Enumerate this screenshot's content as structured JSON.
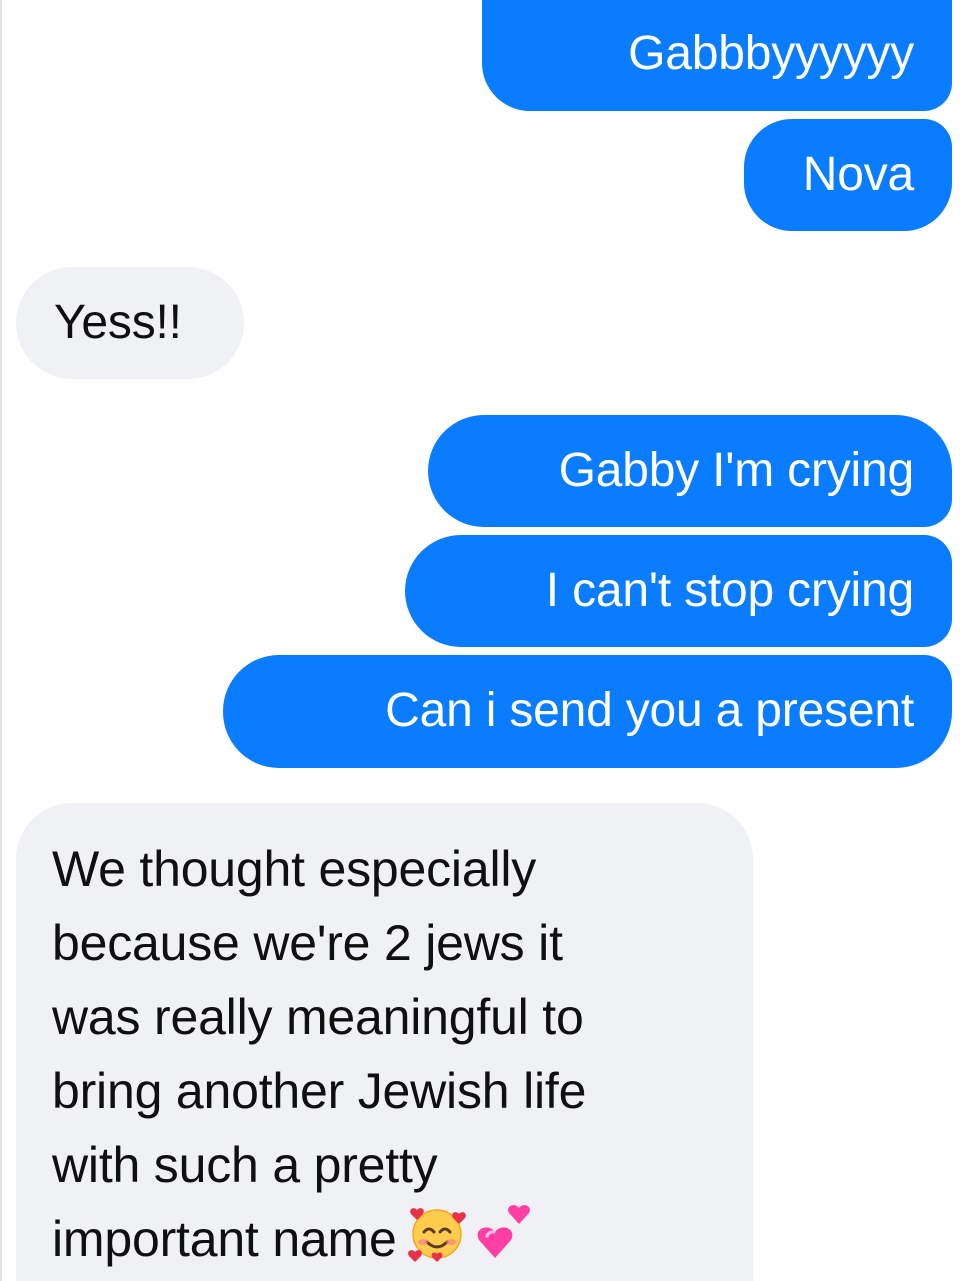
{
  "conversation": {
    "messages": [
      {
        "direction": "sent",
        "text": "Gabbbyyyyyy"
      },
      {
        "direction": "sent",
        "text": "Nova"
      },
      {
        "direction": "received",
        "text": "Yess!!"
      },
      {
        "direction": "sent",
        "text": "Gabby I'm crying"
      },
      {
        "direction": "sent",
        "text": "I can't stop crying"
      },
      {
        "direction": "sent",
        "text": "Can i send you a present"
      },
      {
        "direction": "received",
        "lines": [
          "We thought especially",
          "because we're 2 jews it",
          "was really meaningful to",
          "bring another Jewish life",
          "with such a pretty",
          "important name"
        ],
        "emojis": [
          "smiling-face-with-hearts-icon",
          "two-hearts-icon"
        ]
      }
    ]
  },
  "colors": {
    "sent_bubble": "#0a7cff",
    "received_bubble": "#f0f1f5",
    "sent_text": "#ffffff",
    "received_text": "#101010"
  }
}
